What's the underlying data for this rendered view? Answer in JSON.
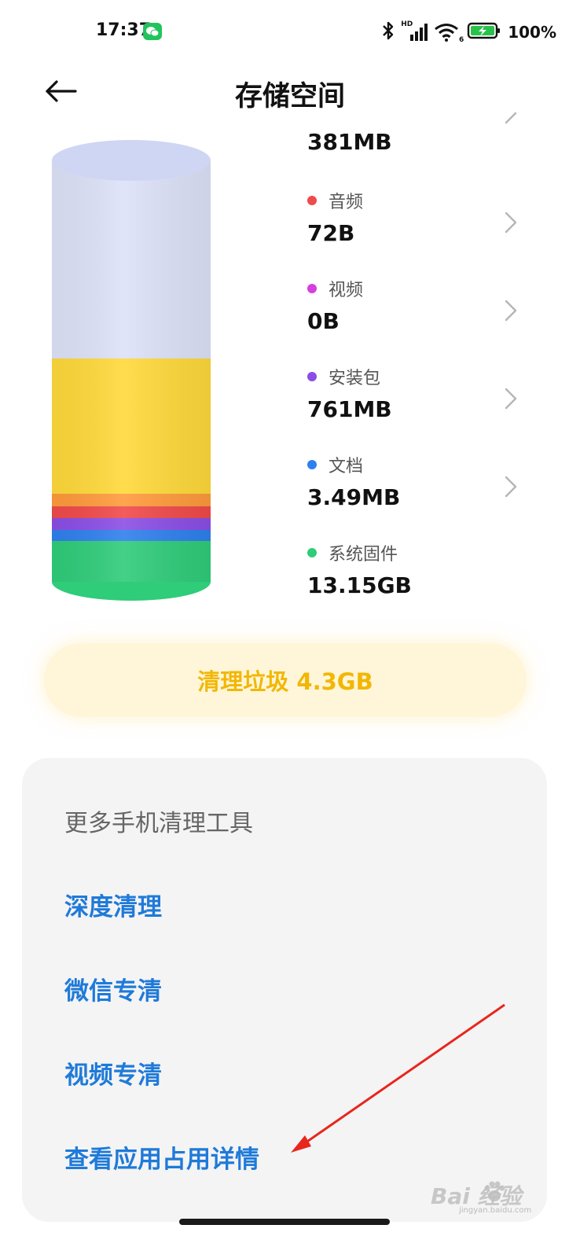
{
  "status_bar": {
    "time": "17:37",
    "battery_percent": "100%",
    "signal_tag": "HD",
    "wifi_tag": "6",
    "icons": [
      "wechat-icon",
      "bluetooth-icon",
      "cellular-signal-icon",
      "wifi-icon",
      "battery-charging-icon"
    ]
  },
  "header": {
    "title": "存储空间",
    "back_icon": "back-arrow-icon"
  },
  "storage_categories": [
    {
      "label": "",
      "size": "381MB",
      "color": "",
      "has_chevron": true
    },
    {
      "label": "音频",
      "size": "72B",
      "color": "#f04a4a",
      "has_chevron": true
    },
    {
      "label": "视频",
      "size": "0B",
      "color": "#d63fe0",
      "has_chevron": true
    },
    {
      "label": "安装包",
      "size": "761MB",
      "color": "#8a4ee6",
      "has_chevron": true
    },
    {
      "label": "文档",
      "size": "3.49MB",
      "color": "#2f80ed",
      "has_chevron": true
    },
    {
      "label": "系统固件",
      "size": "13.15GB",
      "color": "#2fcc7a",
      "has_chevron": false
    }
  ],
  "cylinder_colors": {
    "free": "#dde2f8",
    "used_main": "#ffd93a",
    "orange": "#ff9a3c",
    "red": "#f04a4a",
    "purple": "#8a4ee6",
    "blue": "#2f80ed",
    "green": "#2fcc7a"
  },
  "clean_button": {
    "label": "清理垃圾 4.3GB"
  },
  "tools": {
    "title": "更多手机清理工具",
    "items": [
      "深度清理",
      "微信专清",
      "视频专清",
      "查看应用占用详情"
    ]
  },
  "watermark": {
    "text": "Bai  经验",
    "sub": "jingyan.baidu.com"
  }
}
